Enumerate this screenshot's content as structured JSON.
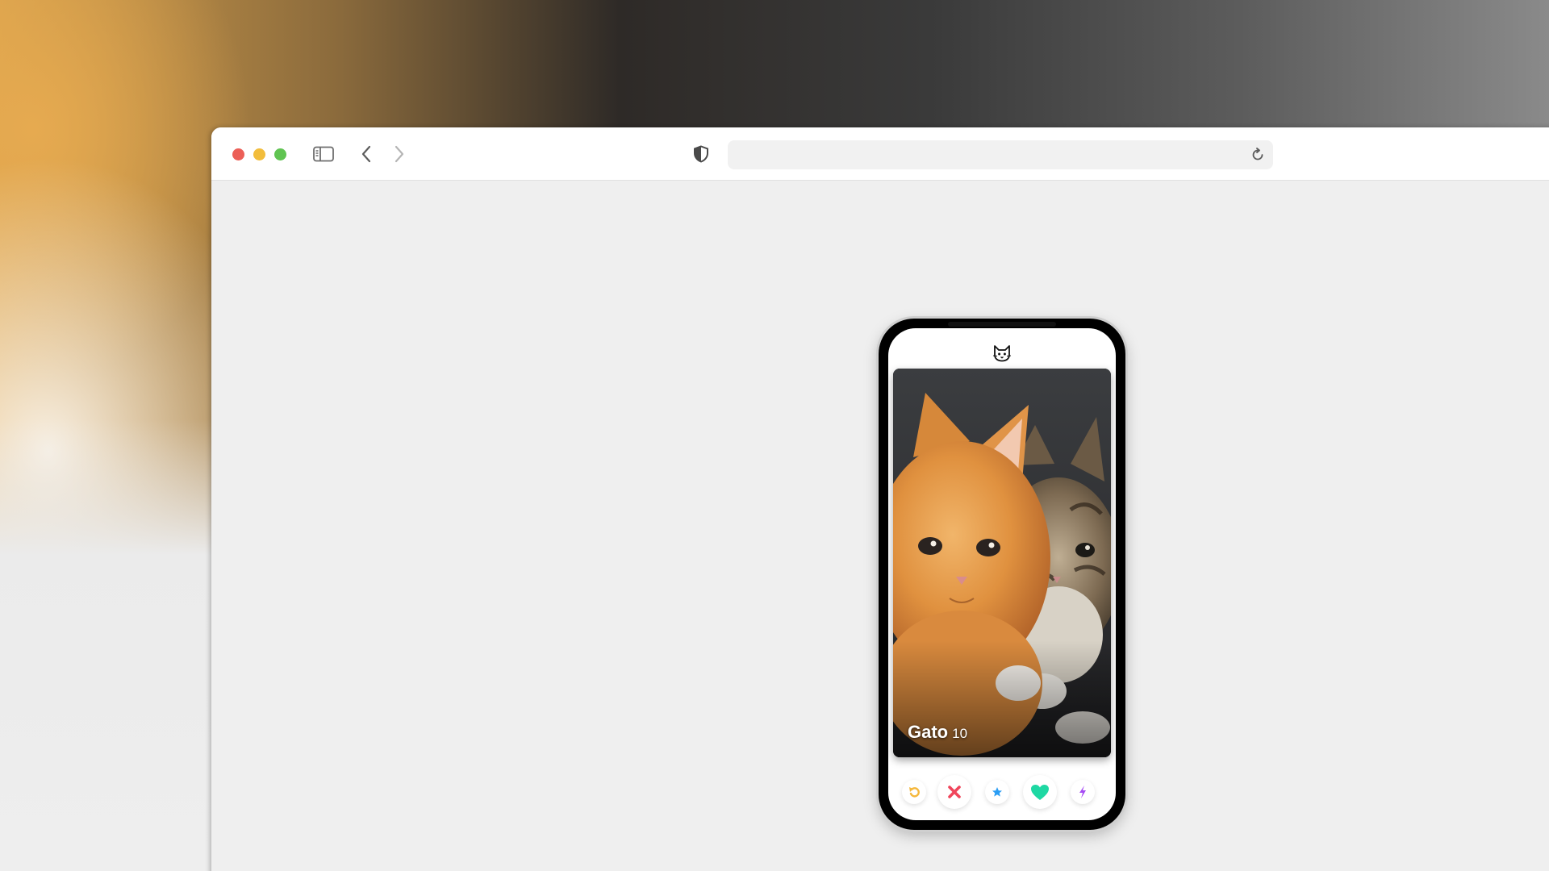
{
  "browser": {
    "address": {
      "value": "",
      "placeholder": ""
    },
    "icons": {
      "sidebar": "sidebar-icon",
      "back": "chevron-left-icon",
      "forward": "chevron-right-icon",
      "privacy": "shield-icon",
      "reload": "reload-icon"
    }
  },
  "app": {
    "logo": "cat-face-icon",
    "card": {
      "name": "Gato",
      "age": "10"
    },
    "actions": [
      {
        "name": "rewind",
        "icon": "rewind-icon",
        "color": "#f5b83d"
      },
      {
        "name": "nope",
        "icon": "close-icon",
        "color": "#f0455b"
      },
      {
        "name": "super-like",
        "icon": "star-icon",
        "color": "#2a9df4"
      },
      {
        "name": "like",
        "icon": "heart-icon",
        "color": "#1ed8a3"
      },
      {
        "name": "boost",
        "icon": "lightning-icon",
        "color": "#a64bf4"
      }
    ]
  },
  "colors": {
    "traffic_close": "#ec5f57",
    "traffic_minimize": "#f2bd3c",
    "traffic_maximize": "#60c452",
    "page_background": "#efefef"
  }
}
